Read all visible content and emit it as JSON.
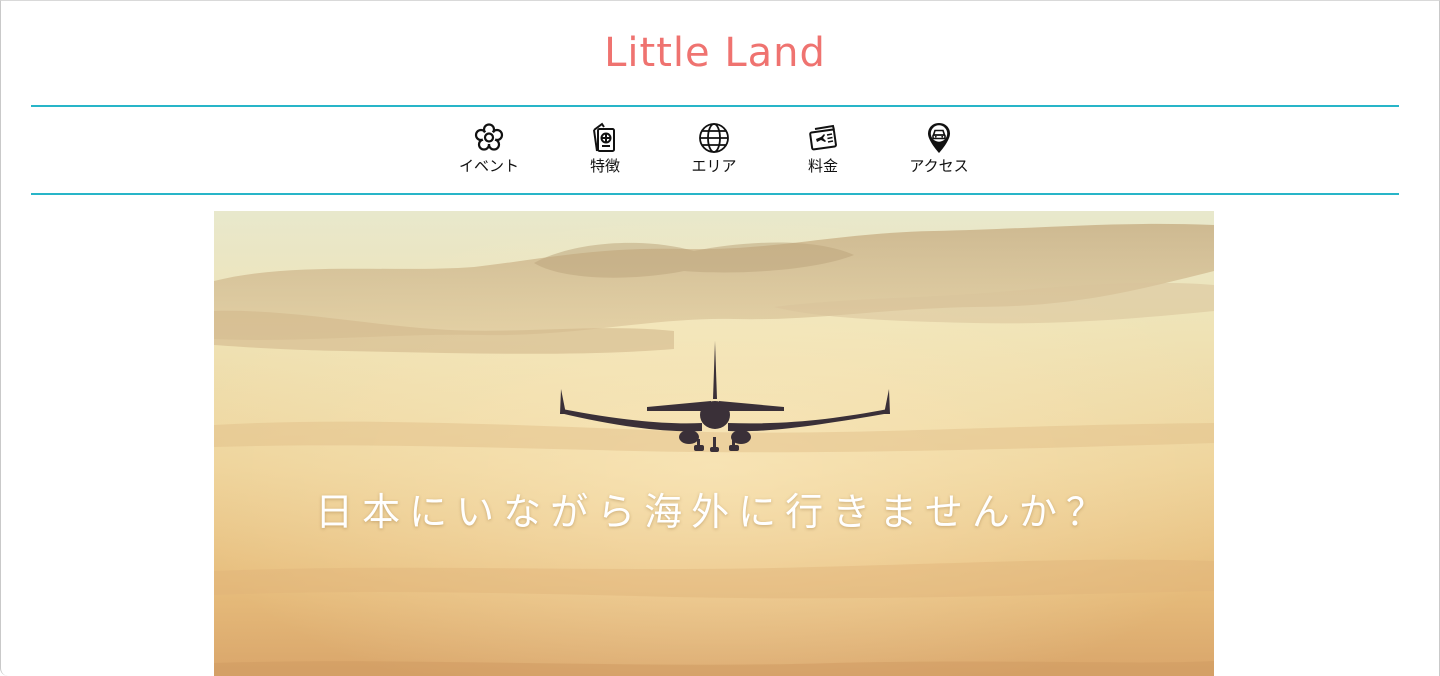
{
  "header": {
    "title": "Little Land"
  },
  "nav": {
    "items": [
      {
        "label": "イベント",
        "icon": "flower-icon"
      },
      {
        "label": "特徴",
        "icon": "passport-icon"
      },
      {
        "label": "エリア",
        "icon": "globe-icon"
      },
      {
        "label": "料金",
        "icon": "ticket-icon"
      },
      {
        "label": "アクセス",
        "icon": "map-pin-car-icon"
      }
    ]
  },
  "hero": {
    "caption": "日本にいながら海外に行きませんか？",
    "image": "airplane-sunset-photo"
  },
  "colors": {
    "title": "#ef7370",
    "nav_border": "#28b5c8",
    "hero_sky_top": "#e6e6c6",
    "hero_sky_bottom": "#d9a56a",
    "caption": "#ffffff"
  }
}
